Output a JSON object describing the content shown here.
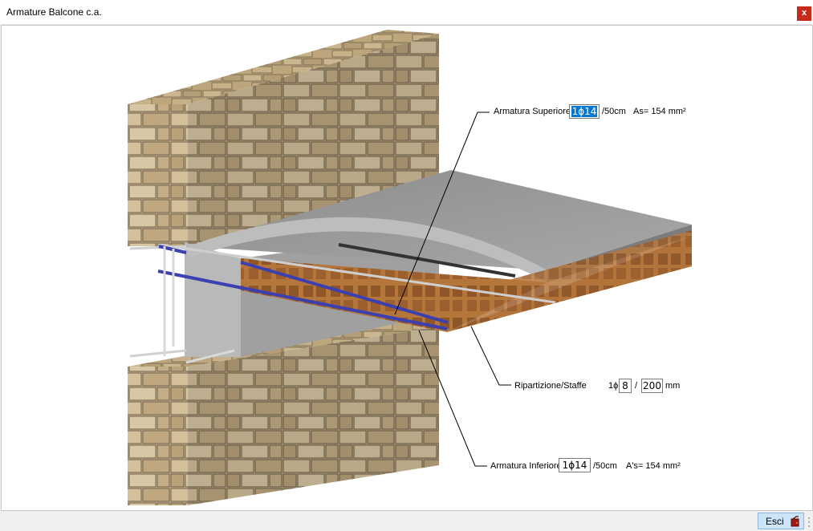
{
  "window": {
    "title": "Armature Balcone c.a.",
    "close_label": "x"
  },
  "annotations": {
    "superiore": {
      "label": "Armatura Superiore",
      "value": "1ϕ14",
      "spacing": "/50cm",
      "area": "As= 154 mm²"
    },
    "ripartizione": {
      "label": "Ripartizione/Staffe",
      "count": "1ϕ",
      "diameter": "8",
      "separator": "/",
      "spacing": "200",
      "unit": "mm"
    },
    "inferiore": {
      "label": "Armatura Inferiore",
      "value": "1ϕ14",
      "spacing": "/50cm",
      "area": "A's= 154 mm²"
    }
  },
  "footer": {
    "exit_label": "Esci"
  },
  "icons": {
    "close": "close-icon",
    "exit": "exit-door-icon"
  },
  "colors": {
    "selection": "#0078d7",
    "brick": "#b5763c",
    "stone": "#c9b48e",
    "concrete": "#9a9a9a",
    "rebar_top": "#3b3fb0",
    "close_bg": "#c42b1c",
    "button_bg": "#cce4f7"
  }
}
